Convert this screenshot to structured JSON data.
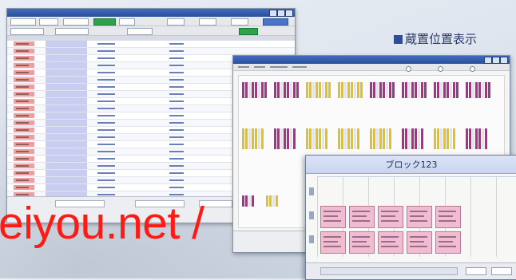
{
  "caption": {
    "text": "蔵置位置表示"
  },
  "block_window": {
    "title": "ブロック123"
  },
  "watermark": {
    "text": "eiyou.net /"
  },
  "colors": {
    "row_marker": "#ef9d9d",
    "row_band": "#c9cdef",
    "block_card": "#f0bcd2",
    "slot_magenta": "#b02d8f",
    "slot_yellow": "#e2c21e",
    "watermark": "#ff1a14"
  },
  "icons": [
    "window-controls",
    "radio-option",
    "side-tab"
  ]
}
